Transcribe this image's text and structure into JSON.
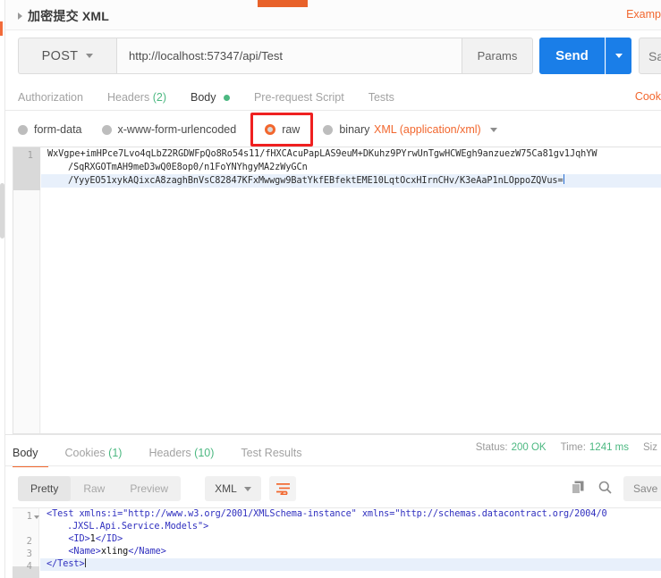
{
  "request": {
    "title": "加密提交 XML",
    "expand_icon": "caret-right-icon",
    "examples_link": "Examp",
    "method": "POST",
    "url": "http://localhost:57347/api/Test",
    "params_label": "Params",
    "send_label": "Send",
    "send_caret_icon": "chevron-down-icon",
    "save_label": "Sa",
    "cookies_link": "Cook"
  },
  "request_tabs": [
    {
      "label": "Authorization",
      "active": false,
      "count": "",
      "dot": false
    },
    {
      "label": "Headers",
      "active": false,
      "count": "(2)",
      "dot": false
    },
    {
      "label": "Body",
      "active": true,
      "count": "",
      "dot": true
    },
    {
      "label": "Pre-request Script",
      "active": false,
      "count": "",
      "dot": false
    },
    {
      "label": "Tests",
      "active": false,
      "count": "",
      "dot": false
    }
  ],
  "body_types": [
    {
      "label": "form-data",
      "checked": false
    },
    {
      "label": "x-www-form-urlencoded",
      "checked": false
    },
    {
      "label": "raw",
      "checked": true
    },
    {
      "label": "binary",
      "checked": false
    }
  ],
  "content_type": {
    "label": "XML (application/xml)",
    "caret_icon": "chevron-down-icon"
  },
  "highlight": {
    "color": "#ef2020",
    "target": "raw"
  },
  "request_body": {
    "line_number": "1",
    "lines": [
      "WxVgpe+imHPce7Lvo4qLbZ2RGDWFpQo8Ro54s11/fHXCAcuPapLAS9euM+DKuhz9PYrwUnTgwHCWEgh9anzuezW75Ca81gv1JqhYW",
      "/SqRXGOTmAH9meD3wQ0E8op0/n1FoYNYhgyMA2zWyGCn",
      "/YyyEO51xykAQixcA8zaghBnVsC82847KFxMwwgw9BatYkfEBfektEME10LqtOcxHIrnCHv/K3eAaP1nLOppoZQVus="
    ]
  },
  "response_tabs": [
    {
      "label": "Body",
      "active": true,
      "count": ""
    },
    {
      "label": "Cookies",
      "active": false,
      "count": "(1)"
    },
    {
      "label": "Headers",
      "active": false,
      "count": "(10)"
    },
    {
      "label": "Test Results",
      "active": false,
      "count": ""
    }
  ],
  "response_meta": [
    {
      "key": "Status:",
      "value": "200 OK"
    },
    {
      "key": "Time:",
      "value": "1241 ms"
    },
    {
      "key": "Siz",
      "value": ""
    }
  ],
  "response_toolbar": {
    "segments": [
      {
        "label": "Pretty",
        "active": true
      },
      {
        "label": "Raw",
        "active": false
      },
      {
        "label": "Preview",
        "active": false
      }
    ],
    "format": "XML",
    "format_caret_icon": "chevron-down-icon",
    "wrap_icon": "word-wrap-icon",
    "copy_icon": "copy-icon",
    "search_icon": "search-icon",
    "save_response_label": "Save R"
  },
  "response_body": {
    "lines": [
      {
        "number": "1",
        "foldable": true,
        "selected": false,
        "segments": [
          {
            "text": "<Test ",
            "cls": "tagc"
          },
          {
            "text": "xmlns:i=\"http://www.w3.org/2001/XMLSchema-instance\" xmlns=\"http://schemas.datacontract.org/2004/0",
            "cls": "attrn"
          }
        ]
      },
      {
        "number": "",
        "foldable": false,
        "selected": false,
        "continuation": true,
        "segments": [
          {
            "text": ".JXSL.Api.Service.Models\">",
            "cls": "attrn"
          }
        ]
      },
      {
        "number": "2",
        "foldable": false,
        "selected": false,
        "segments": [
          {
            "text": "    <ID>",
            "cls": "tagc"
          },
          {
            "text": "1",
            "cls": "txtc"
          },
          {
            "text": "</ID>",
            "cls": "tagc"
          }
        ]
      },
      {
        "number": "3",
        "foldable": false,
        "selected": false,
        "segments": [
          {
            "text": "    <Name>",
            "cls": "tagc"
          },
          {
            "text": "xling",
            "cls": "txtc"
          },
          {
            "text": "</Name>",
            "cls": "tagc"
          }
        ]
      },
      {
        "number": "4",
        "foldable": false,
        "selected": true,
        "segments": [
          {
            "text": "</Test>",
            "cls": "tagc"
          }
        ]
      }
    ]
  },
  "colors": {
    "accent_orange": "#f2672e",
    "send_blue": "#1a7ee8",
    "green": "#4cb881",
    "highlight_red": "#ef2020"
  }
}
